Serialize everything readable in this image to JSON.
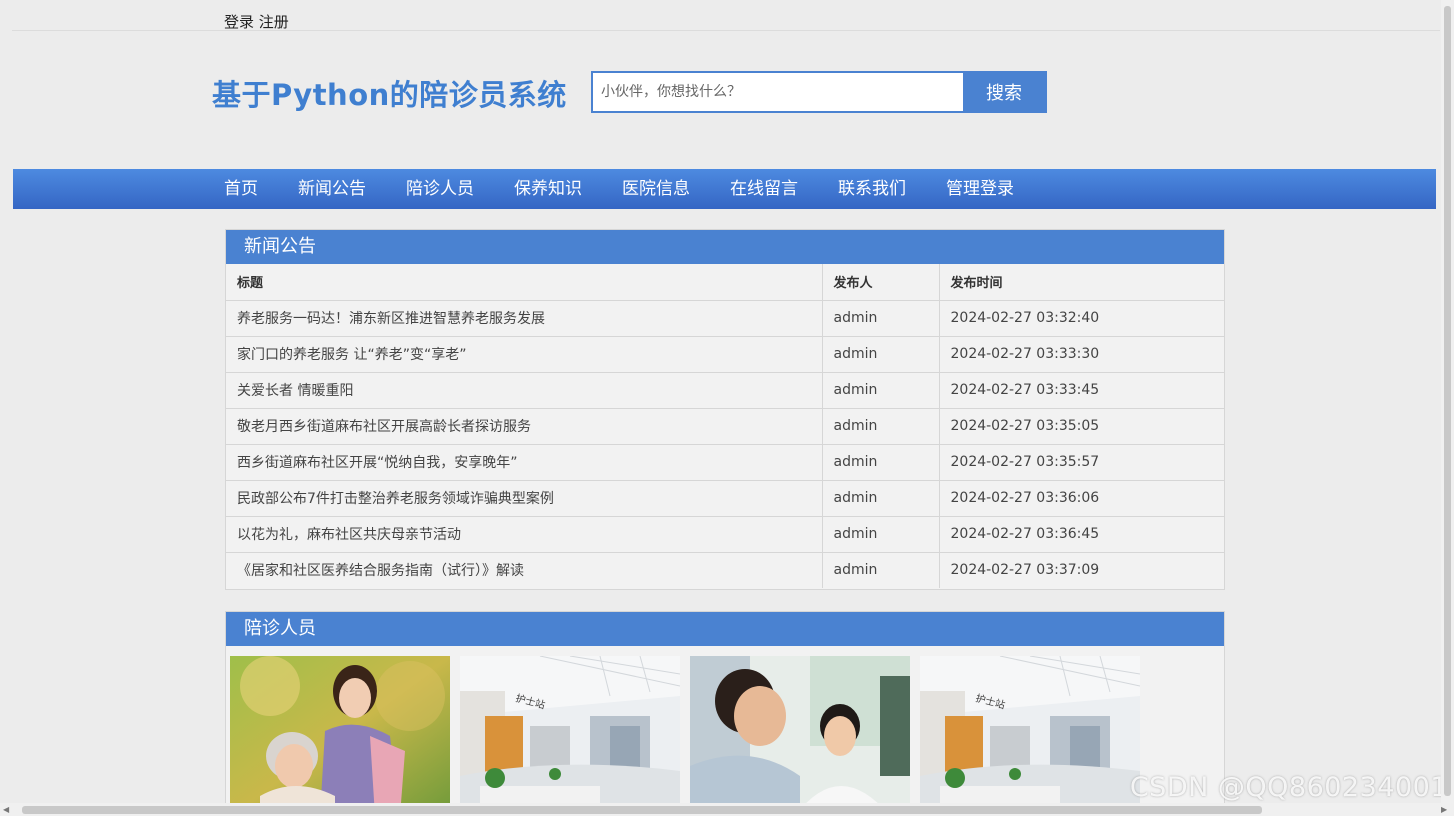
{
  "topbar": {
    "login": "登录",
    "register": "注册"
  },
  "header": {
    "title": "基于Python的陪诊员系统"
  },
  "search": {
    "placeholder": "小伙伴，你想找什么？",
    "button_label": "搜索"
  },
  "nav": {
    "items": [
      {
        "label": "首页"
      },
      {
        "label": "新闻公告"
      },
      {
        "label": "陪诊人员"
      },
      {
        "label": "保养知识"
      },
      {
        "label": "医院信息"
      },
      {
        "label": "在线留言"
      },
      {
        "label": "联系我们"
      },
      {
        "label": "管理登录"
      }
    ]
  },
  "news": {
    "header": "新闻公告",
    "columns": {
      "title": "标题",
      "author": "发布人",
      "time": "发布时间"
    },
    "rows": [
      {
        "title": "养老服务一码达！浦东新区推进智慧养老服务发展",
        "author": "admin",
        "time": "2024-02-27 03:32:40"
      },
      {
        "title": "家门口的养老服务 让“养老”变“享老”",
        "author": "admin",
        "time": "2024-02-27 03:33:30"
      },
      {
        "title": "关爱长者 情暖重阳",
        "author": "admin",
        "time": "2024-02-27 03:33:45"
      },
      {
        "title": "敬老月西乡街道麻布社区开展高龄长者探访服务",
        "author": "admin",
        "time": "2024-02-27 03:35:05"
      },
      {
        "title": "西乡街道麻布社区开展“悦纳自我，安享晚年”",
        "author": "admin",
        "time": "2024-02-27 03:35:57"
      },
      {
        "title": "民政部公布7件打击整治养老服务领域诈骗典型案例",
        "author": "admin",
        "time": "2024-02-27 03:36:06"
      },
      {
        "title": "以花为礼，麻布社区共庆母亲节活动",
        "author": "admin",
        "time": "2024-02-27 03:36:45"
      },
      {
        "title": "《居家和社区医养结合服务指南（试行）》解读",
        "author": "admin",
        "time": "2024-02-27 03:37:09"
      }
    ]
  },
  "staff": {
    "header": "陪诊人员",
    "photos": [
      {
        "name": "caregiver-elderly-photo"
      },
      {
        "name": "nurse-station-photo"
      },
      {
        "name": "doctor-consult-photo"
      },
      {
        "name": "nurse-station-photo"
      }
    ]
  },
  "watermark": "CSDN @QQ860234001",
  "colors": {
    "accent": "#4a82d1",
    "title": "#3f7fd0",
    "background": "#ececec"
  }
}
